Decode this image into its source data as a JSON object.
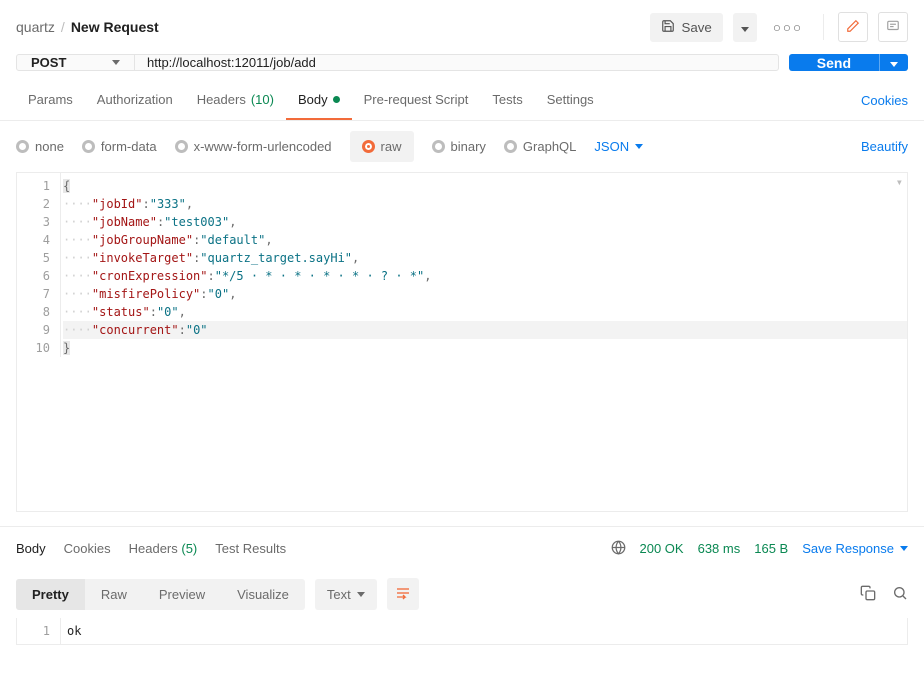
{
  "breadcrumb": {
    "parent": "quartz",
    "sep": "/",
    "current": "New Request"
  },
  "topbar": {
    "save_label": "Save"
  },
  "request": {
    "method": "POST",
    "url": "http://localhost:12011/job/add",
    "send_label": "Send"
  },
  "req_tabs": {
    "params": "Params",
    "authorization": "Authorization",
    "headers": "Headers",
    "headers_count": "(10)",
    "body": "Body",
    "pre_request": "Pre-request Script",
    "tests": "Tests",
    "settings": "Settings",
    "cookies": "Cookies"
  },
  "body_types": {
    "none": "none",
    "form_data": "form-data",
    "x_www": "x-www-form-urlencoded",
    "raw": "raw",
    "binary": "binary",
    "graphql": "GraphQL",
    "raw_format": "JSON",
    "beautify": "Beautify"
  },
  "editor": {
    "line_numbers": [
      "1",
      "2",
      "3",
      "4",
      "5",
      "6",
      "7",
      "8",
      "9",
      "10"
    ],
    "l1_open": "{",
    "l2_ws": "····",
    "l2_key": "\"jobId\"",
    "l2_colon": ":",
    "l2_val": "\"333\"",
    "l2_comma": ",",
    "l3_ws": "····",
    "l3_key": "\"jobName\"",
    "l3_colon": ":",
    "l3_val": "\"test003\"",
    "l3_comma": ",",
    "l4_ws": "····",
    "l4_key": "\"jobGroupName\"",
    "l4_colon": ":",
    "l4_val": "\"default\"",
    "l4_comma": ",",
    "l5_ws": "····",
    "l5_key": "\"invokeTarget\"",
    "l5_colon": ":",
    "l5_val": "\"quartz_target.sayHi\"",
    "l5_comma": ",",
    "l6_ws": "····",
    "l6_key": "\"cronExpression\"",
    "l6_colon": ":",
    "l6_val": "\"*/5 · * · * · * · * · ? · *\"",
    "l6_comma": ",",
    "l7_ws": "····",
    "l7_key": "\"misfirePolicy\"",
    "l7_colon": ":",
    "l7_val": "\"0\"",
    "l7_comma": ",",
    "l8_ws": "····",
    "l8_key": "\"status\"",
    "l8_colon": ":",
    "l8_val": "\"0\"",
    "l8_comma": ",",
    "l9_ws": "····",
    "l9_key": "\"concurrent\"",
    "l9_colon": ":",
    "l9_val": "\"0\"",
    "l10_close": "}"
  },
  "response": {
    "tabs": {
      "body": "Body",
      "cookies": "Cookies",
      "headers": "Headers",
      "headers_count": "(5)",
      "tests": "Test Results"
    },
    "status": "200 OK",
    "time": "638 ms",
    "size": "165 B",
    "save": "Save Response",
    "views": {
      "pretty": "Pretty",
      "raw": "Raw",
      "preview": "Preview",
      "visualize": "Visualize",
      "format": "Text"
    },
    "body_line_numbers": [
      "1"
    ],
    "body_text": "ok"
  }
}
